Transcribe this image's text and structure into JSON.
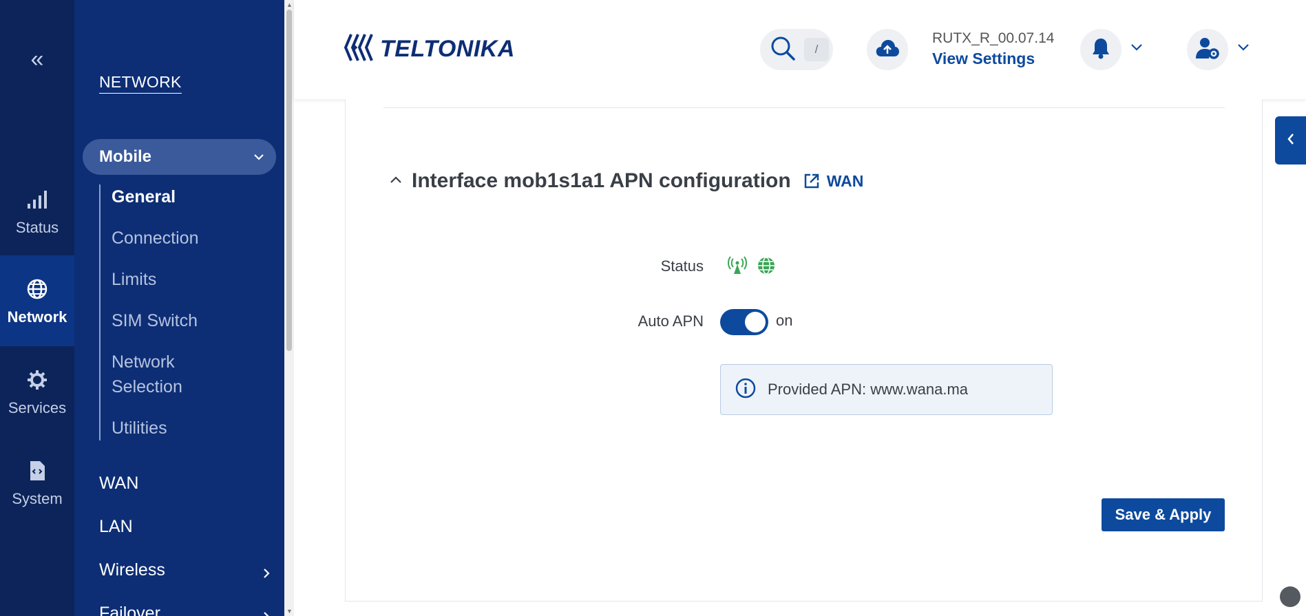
{
  "rail": {
    "items": [
      {
        "label": "Status",
        "icon": "signal-bars-icon"
      },
      {
        "label": "Network",
        "icon": "globe-icon",
        "active": true
      },
      {
        "label": "Services",
        "icon": "gear-icon"
      },
      {
        "label": "System",
        "icon": "file-code-icon"
      }
    ]
  },
  "menu": {
    "section_title": "NETWORK",
    "group_label": "Mobile",
    "submenu": [
      {
        "label": "General",
        "active": true
      },
      {
        "label": "Connection"
      },
      {
        "label": "Limits"
      },
      {
        "label": "SIM Switch"
      },
      {
        "label": "Network Selection"
      },
      {
        "label": "Utilities"
      }
    ],
    "items": [
      {
        "label": "WAN"
      },
      {
        "label": "LAN"
      },
      {
        "label": "Wireless",
        "has_children": true
      },
      {
        "label": "Failover",
        "has_children": true
      }
    ]
  },
  "header": {
    "logo_text": "TELTONIKA",
    "search_shortcut": "/",
    "firmware_version": "RUTX_R_00.07.14",
    "view_settings": "View Settings"
  },
  "section": {
    "title": "Interface mob1s1a1 APN configuration",
    "wan_link": "WAN",
    "status_label": "Status",
    "auto_apn_label": "Auto APN",
    "auto_apn_state": "on",
    "auto_apn_enabled": true,
    "info_text": "Provided APN: www.wana.ma",
    "save_label": "Save & Apply"
  },
  "colors": {
    "rail_bg": "#0c2459",
    "menu_bg": "#0d2e75",
    "accent": "#0d4a9e",
    "status_green": "#3aa655"
  }
}
